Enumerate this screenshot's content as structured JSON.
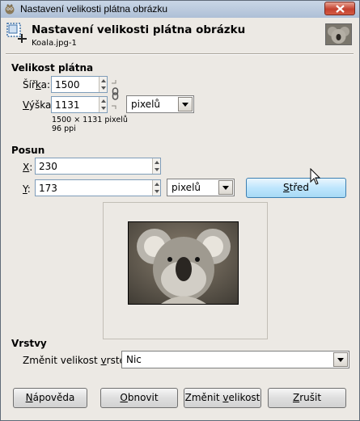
{
  "window": {
    "title": "Nastavení velikosti plátna obrázku"
  },
  "header": {
    "title": "Nastavení velikosti plátna obrázku",
    "subtitle": "Koala.jpg-1"
  },
  "canvas_size": {
    "section_title": "Velikost plátna",
    "width_label_pre": "Šíř",
    "width_label_ul": "k",
    "width_label_post": "a:",
    "width_value": "1500",
    "height_label_pre": "",
    "height_label_ul": "V",
    "height_label_post": "ýška:",
    "height_value": "1131",
    "unit": "pixelů",
    "info_size": "1500 × 1131 pixelů",
    "info_res": "96 ppi"
  },
  "offset": {
    "section_title": "Posun",
    "x_label_ul": "X",
    "x_label_post": ":",
    "x_value": "230",
    "y_label_ul": "Y",
    "y_label_post": ":",
    "y_value": "173",
    "unit": "pixelů",
    "center_ul": "S",
    "center_post": "třed"
  },
  "layers": {
    "section_title": "Vrstvy",
    "resize_label_pre": "Změnit velikost ",
    "resize_label_ul": "v",
    "resize_label_post": "rstev:",
    "resize_value": "Nic"
  },
  "buttons": {
    "help_ul": "N",
    "help_post": "ápověda",
    "reset_ul": "O",
    "reset_post": "bnovit",
    "resize_pre": "Změnit ",
    "resize_ul": "v",
    "resize_post": "elikost",
    "cancel_ul": "Z",
    "cancel_post": "rušit"
  },
  "colors": {
    "title_bar": "#aebfd6",
    "hot_button": "#bee6fd"
  }
}
